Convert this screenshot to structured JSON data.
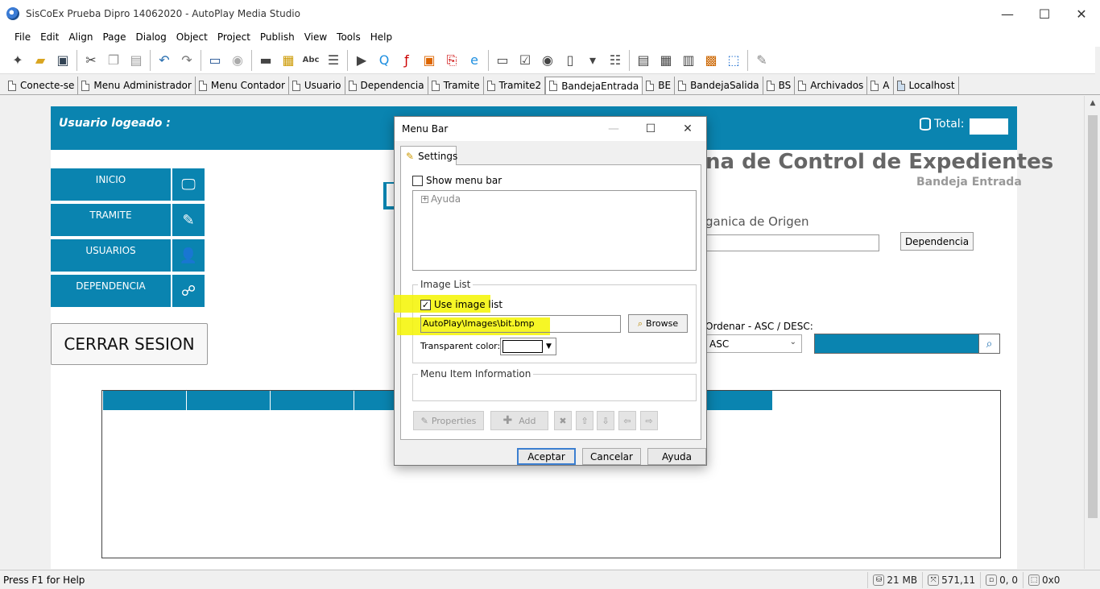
{
  "window": {
    "title": "SisCoEx Prueba Dipro 14062020 - AutoPlay Media Studio",
    "controls": [
      "—",
      "☐",
      "✕"
    ]
  },
  "menubar": [
    "File",
    "Edit",
    "Align",
    "Page",
    "Dialog",
    "Object",
    "Project",
    "Publish",
    "View",
    "Tools",
    "Help"
  ],
  "toolbar_icons": [
    "wand-icon",
    "open-folder-icon",
    "save-icon",
    "cut-icon",
    "copy-icon",
    "paste-icon",
    "undo-icon",
    "redo-icon",
    "preview-icon",
    "publish-disc-icon",
    "button-object-icon",
    "image-object-icon",
    "label-object-icon",
    "paragraph-object-icon",
    "video-object-icon",
    "quicktime-object-icon",
    "flash-object-icon",
    "slideshow-object-icon",
    "pdf-object-icon",
    "web-object-icon",
    "input-object-icon",
    "checkbox-object-icon",
    "radio-object-icon",
    "listbox-object-icon",
    "combobox-object-icon",
    "tree-object-icon",
    "grid-object-icon",
    "table-object-icon",
    "progress-object-icon",
    "plugin-object-icon",
    "selection-icon",
    "pencil-icon"
  ],
  "page_tabs": [
    "Conecte-se",
    "Menu Administrador",
    "Menu Contador",
    "Usuario",
    "Dependencia",
    "Tramite",
    "Tramite2",
    "BandejaEntrada",
    "BE",
    "BandejaSalida",
    "BS",
    "Archivados",
    "A",
    "Localhost"
  ],
  "active_tab": "BandejaEntrada",
  "canvas": {
    "user_label": "Usuario logeado :",
    "total_label": "Total:",
    "title": "na de Control de Expedientes",
    "subtitle": "Bandeja Entrada",
    "nav": [
      {
        "label": "INICIO",
        "icon": "monitor-icon"
      },
      {
        "label": "TRAMITE",
        "icon": "edit-icon"
      },
      {
        "label": "USUARIOS",
        "icon": "user-icon"
      },
      {
        "label": "DEPENDENCIA",
        "icon": "org-chart-icon"
      }
    ],
    "logout_label": "CERRAR SESION",
    "origin_label": "ganica de Origen",
    "dependencia_button": "Dependencia",
    "order_label": "Ordenar - ASC / DESC:",
    "order_value": "ASC"
  },
  "dialog": {
    "title": "Menu Bar",
    "tab": "Settings",
    "show_menu_bar": {
      "label": "Show menu bar",
      "checked": false
    },
    "tree_item": "Ayuda",
    "image_list": {
      "group_label": "Image List",
      "use_image_list": {
        "label": "Use image list",
        "checked": true
      },
      "path": "AutoPlay\\Images\\bit.bmp",
      "browse_label": "Browse",
      "transparent_label": "Transparent color:",
      "transparent_color": "#ffffff"
    },
    "menu_item_info_label": "Menu Item Information",
    "properties_label": "Properties",
    "add_label": "Add",
    "buttons": {
      "ok": "Aceptar",
      "cancel": "Cancelar",
      "help": "Ayuda"
    }
  },
  "status": {
    "help": "Press F1 for Help",
    "memory": "21 MB",
    "cursor": "571,11",
    "selection": "0, 0",
    "size": "0x0"
  },
  "colors": {
    "brand": "#0a84b0",
    "highlight": "#f5f500"
  }
}
